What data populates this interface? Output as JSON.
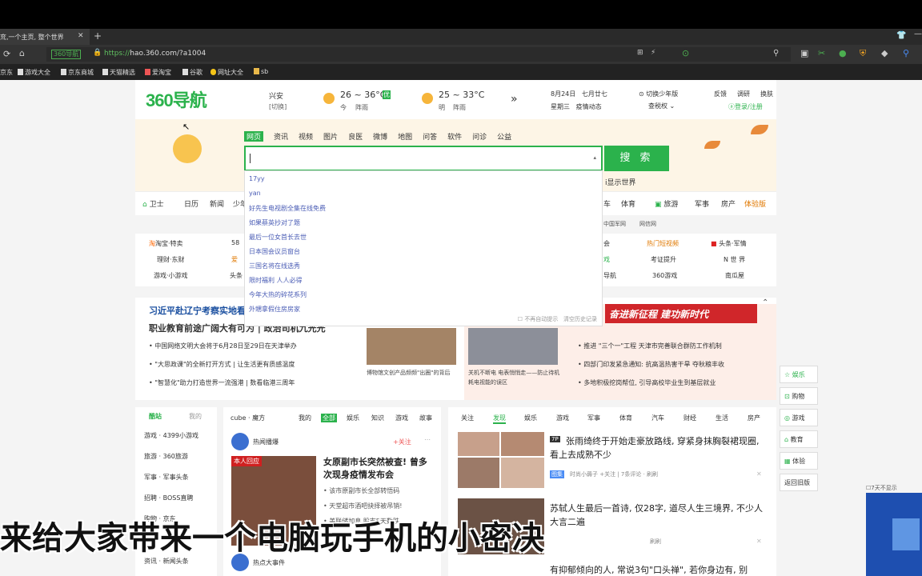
{
  "browser": {
    "tab_title": "㐬,一个主页, 整个世界",
    "tab_close": "✕",
    "tab_new": "+",
    "site_badge": "360导航",
    "url_scheme": "https://",
    "url_rest": "hao.360.com/?a1004"
  },
  "bookmarks": [
    "京东",
    "游戏大全",
    "京东商城",
    "天猫精选",
    "爱淘宝",
    "谷歌",
    "网址大全",
    "sb"
  ],
  "header": {
    "logo": "360导航",
    "city": "兴安",
    "city_switch": "[切换]",
    "today_temp": "26 ~ 36°C",
    "today_badge": "优",
    "today_label": "今",
    "today_weather": "阵雨",
    "tomorrow_temp": "25 ~ 33°C",
    "tomorrow_label": "明",
    "tomorrow_weather": "阵雨",
    "next": "»",
    "date": "8月24日",
    "lunar": "七月廿七",
    "weekday": "星期三",
    "news_link": "疫情动态",
    "switch_youth": "切换少年版",
    "skin": "查税权",
    "feedback": "反馈",
    "survey": "调研",
    "change_skin": "换肤",
    "login": "登录/注册"
  },
  "search": {
    "tabs": [
      "网页",
      "资讯",
      "视频",
      "图片",
      "良医",
      "微博",
      "地图",
      "问答",
      "软件",
      "问诊",
      "公益"
    ],
    "button": "搜 索",
    "suggestions": [
      "17yy",
      "yan",
      "好先生电视剧全集在线免费",
      "如果蔡英抄对了题",
      "最后一位女首长去世",
      "日本国会议员窗台",
      "三国名将在线选秀",
      "限时福利 人人必得",
      "今年大热的碎花系列",
      "外甥拿假住房房家"
    ],
    "footer_hide": "不再自动提示",
    "footer_clear": "清空历史记录",
    "behind_text": "i显示世界"
  },
  "navrow": [
    "卫士",
    "日历",
    "新闻",
    "少年",
    "车",
    "体育",
    "旅游",
    "军事",
    "房产",
    "体验版"
  ],
  "navrow2": [
    "中国军网",
    "网信网"
  ],
  "sites": {
    "left": [
      "淘宝·特卖",
      "理财·东财",
      "游戏·小游戏"
    ],
    "left2": [
      "58",
      "爱",
      "头条"
    ],
    "right_a": [
      "会",
      "戏",
      "导航"
    ],
    "right_b": [
      "热门短视频",
      "考证提升",
      "360游戏"
    ],
    "right_c": [
      "头条·军情",
      "N 世 界",
      "南瓜屋"
    ]
  },
  "news": {
    "headline1": "习近平赴辽宁考察实地看新闻",
    "headline2": "职业教育前途广阔大有可为 | 政治司机九光光",
    "items": [
      "中国网络文明大会将于6月28日至29日在天津举办",
      "\"大思政课\"的全新打开方式 | 让生活更有质感温度",
      "\"智慧化\"助力打造世界一流强港 | 数看临港三周年"
    ],
    "cap1": "博物馆文创产品频频\"出圈\"的背后",
    "cap2": "关机不断电 电表悄悄走——防止待机耗电视能的误区",
    "banner": "奋进新征程   建功新时代",
    "right_items": [
      "推进 \"三个一\"工程 天津市完善联合群防工作机制",
      "四部门印发紧急通知: 抗高温热害干旱 夺秋粮丰收",
      "多地积极挖岗帮位, 引导高校毕业生到基层就业"
    ]
  },
  "col1": {
    "tab_on": "酷站",
    "tab_off": "我的",
    "links": [
      "游戏 · 4399小游戏",
      "旅游 · 360旅游",
      "军事 · 军事头条",
      "招聘 · BOSS直聘",
      "购物 · 京东",
      "",
      "资讯 · 新闻头条"
    ]
  },
  "col2": {
    "brand": "cube · 魔方",
    "tabs": [
      "我的",
      "全部",
      "娱乐",
      "知识",
      "游戏",
      "故事"
    ],
    "card1_title": "热闻播爆",
    "follow": "+关注",
    "card_badge": "本人回应",
    "card_headline": "女原副市长突然被查! 曾多次现身疫情发布会",
    "card_lines": [
      "该市原副市长全部转悟码",
      "天堂超市酒吧抉择被吊销!",
      "美联储加息 股市5天数跌"
    ],
    "card2_title": "热点大事件"
  },
  "col3": {
    "tabs": [
      "关注",
      "发现",
      "娱乐",
      "游戏",
      "军事",
      "体育",
      "汽车",
      "财经",
      "生活",
      "房产"
    ],
    "item1_badge": "7P",
    "item1": "张雨绮终于开始走豪放路线, 穿紧身抹胸裂裙现圈, 看上去成熟不少",
    "item1_tag": "图集",
    "item1_meta": "时尚小薅子 +关注 | 7条评论 · 刷刷",
    "item2": "苏轼人生最后一首诗, 仅28字, 道尽人生三境界, 不少人大言二遍",
    "item2_meta": "刷刷",
    "item3": "有抑郁倾向的人, 常说3句\"口头禅\", 若你身边有, 别"
  },
  "sidebar": [
    "娱乐",
    "购物",
    "游戏",
    "教育",
    "体验",
    "返回旧版"
  ],
  "taskbar_hint": "7天不显示",
  "subtitle": "来给大家带来一个电脑玩手机的小密决"
}
